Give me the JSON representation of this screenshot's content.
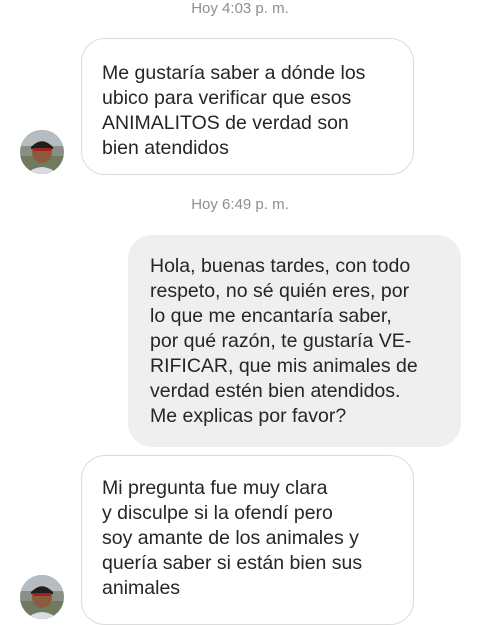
{
  "conversation": {
    "messages": [
      {
        "type": "timestamp",
        "text": "Hoy 4:03 p. m."
      },
      {
        "type": "incoming",
        "text": "Me gustaría saber a dónde los\nubico para verificar que esos\nANIMALITOS de verdad son\nbien atendidos"
      },
      {
        "type": "timestamp",
        "text": "Hoy 6:49 p. m."
      },
      {
        "type": "outgoing",
        "text": "Hola, buenas tardes, con todo\nrespeto, no sé quién eres, por\nlo que me encantaría saber,\npor qué razón, te gustaría VE-\nRIFICAR, que mis animales de\nverdad estén bien atendidos.\nMe explicas por favor?"
      },
      {
        "type": "incoming",
        "text": "Mi pregunta fue muy clara\ny disculpe si la ofendí pero\nsoy amante de los animales y\nquería saber si están bien sus\nanimales"
      }
    ]
  },
  "colors": {
    "incoming_border": "#dbdbdb",
    "outgoing_background": "#efefef",
    "timestamp_text": "#8e8e8e",
    "message_text": "#262626"
  },
  "icons": {
    "avatar": "contact-avatar-photo"
  }
}
